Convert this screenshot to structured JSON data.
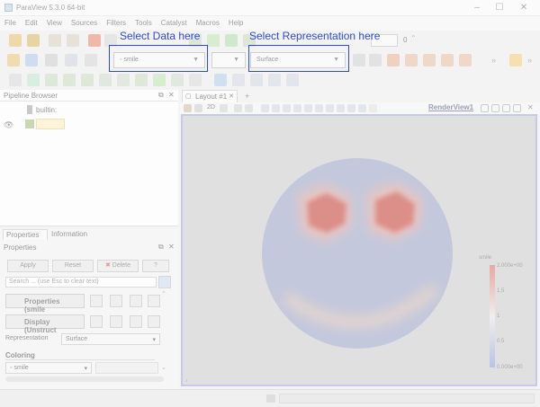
{
  "window": {
    "title": "ParaView 5.3.0 64-bit"
  },
  "menu": [
    "File",
    "Edit",
    "View",
    "Sources",
    "Filters",
    "Tools",
    "Catalyst",
    "Macros",
    "Help"
  ],
  "toolbar": {
    "time_value": "0",
    "data_combo_value": "smile",
    "representation_combo_value": "Surface"
  },
  "callouts": {
    "data": "Select Data here",
    "representation": "Select Representation here"
  },
  "pipeline": {
    "title": "Pipeline Browser",
    "root": "builtin:",
    "item": ""
  },
  "tabs": {
    "properties": "Properties",
    "information": "Information"
  },
  "properties": {
    "title": "Properties",
    "apply": "Apply",
    "reset": "Reset",
    "delete": "Delete",
    "help": "?",
    "search_placeholder": "Search ... (use Esc to clear text)",
    "section_properties": "Properties (smile",
    "section_display": "Display (Unstruct",
    "representation_label": "Representation",
    "representation_value": "Surface",
    "coloring_label": "Coloring",
    "coloring_value": "smile"
  },
  "layout": {
    "tab_label": "Layout #1",
    "add_tab": "+",
    "zoom": "2D",
    "view_name": "RenderView1"
  },
  "colorbar": {
    "title": "smile",
    "ticks": [
      "2.000e+00",
      "1.5",
      "1",
      "0.5",
      "0.000e+00"
    ]
  },
  "colors": {
    "selection_accent": "#2f49d8",
    "sphere": "#c4c8dc",
    "hot": "#d98a86",
    "warm": "#eec8b8",
    "render_bg": "#e0e0e0"
  }
}
